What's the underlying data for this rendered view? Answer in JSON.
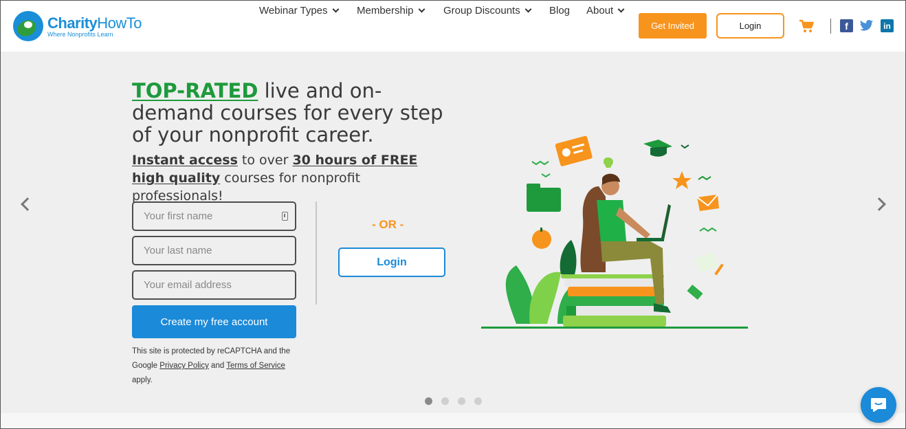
{
  "brand": {
    "name_a": "Charity",
    "name_b": "HowTo",
    "tagline": "Where Nonprofits Learn",
    "colors": {
      "blue": "#1b8ad8",
      "green": "#1e9a3c",
      "orange": "#f7941d"
    }
  },
  "nav": {
    "items": [
      {
        "label": "Webinar Types",
        "dropdown": true
      },
      {
        "label": "Membership",
        "dropdown": true
      },
      {
        "label": "Group Discounts",
        "dropdown": true
      },
      {
        "label": "Blog",
        "dropdown": false
      },
      {
        "label": "About",
        "dropdown": true
      }
    ],
    "get_invited": "Get Invited",
    "login": "Login",
    "icons": [
      "cart-icon",
      "facebook-icon",
      "twitter-icon",
      "linkedin-icon"
    ]
  },
  "hero": {
    "headline_highlight": "TOP-RATED",
    "headline_rest": " live and on-demand courses for every step of your nonprofit career.",
    "sub_a": "Instant access",
    "sub_b": " to over ",
    "sub_c": "30 hours of FREE high quality",
    "sub_d": " courses for nonprofit professionals!",
    "form": {
      "first_name_placeholder": "Your first name",
      "last_name_placeholder": "Your last name",
      "email_placeholder": "Your email address",
      "submit": "Create my free account"
    },
    "recaptcha": {
      "a": "This site is protected by reCAPTCHA and the Google ",
      "privacy": "Privacy Policy",
      "and": " and ",
      "terms": "Terms of Service",
      "end": " apply."
    },
    "or": "- OR -",
    "login": "Login"
  },
  "carousel": {
    "slides": 4,
    "active": 1
  }
}
